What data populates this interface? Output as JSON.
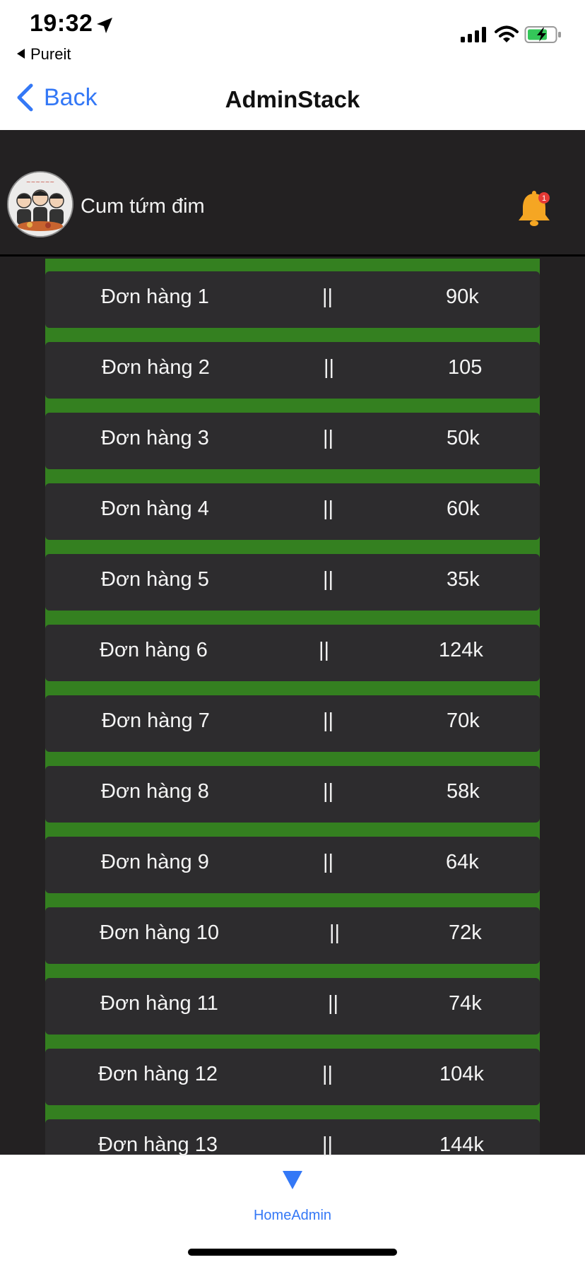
{
  "status_bar": {
    "time": "19:32",
    "back_app": "Pureit"
  },
  "nav": {
    "back_label": "Back",
    "title": "AdminStack"
  },
  "profile": {
    "name": "Cum tứm đim",
    "notification_count": "1"
  },
  "orders": [
    {
      "name": "Đơn hàng 1",
      "sep": "||",
      "price": "90k"
    },
    {
      "name": "Đơn hàng 2",
      "sep": "||",
      "price": "105"
    },
    {
      "name": "Đơn hàng 3",
      "sep": "||",
      "price": "50k"
    },
    {
      "name": "Đơn hàng 4",
      "sep": "||",
      "price": "60k"
    },
    {
      "name": "Đơn hàng 5",
      "sep": "||",
      "price": "35k"
    },
    {
      "name": "Đơn hàng 6",
      "sep": "||",
      "price": "124k"
    },
    {
      "name": "Đơn hàng 7",
      "sep": "||",
      "price": "70k"
    },
    {
      "name": "Đơn hàng 8",
      "sep": "||",
      "price": "58k"
    },
    {
      "name": "Đơn hàng 9",
      "sep": "||",
      "price": "64k"
    },
    {
      "name": "Đơn hàng 10",
      "sep": "||",
      "price": "72k"
    },
    {
      "name": "Đơn hàng 11",
      "sep": "||",
      "price": "74k"
    },
    {
      "name": "Đơn hàng 12",
      "sep": "||",
      "price": "104k"
    },
    {
      "name": "Đơn hàng 13",
      "sep": "||",
      "price": "144k"
    }
  ],
  "tab_bar": {
    "items": [
      {
        "label": "HomeAdmin",
        "icon": "triangle-down-icon"
      }
    ]
  },
  "colors": {
    "accent": "#3478f6",
    "dark_bg": "#232122",
    "row_bg": "#2d2c2e",
    "green": "#348020",
    "bell": "#f5a623"
  }
}
